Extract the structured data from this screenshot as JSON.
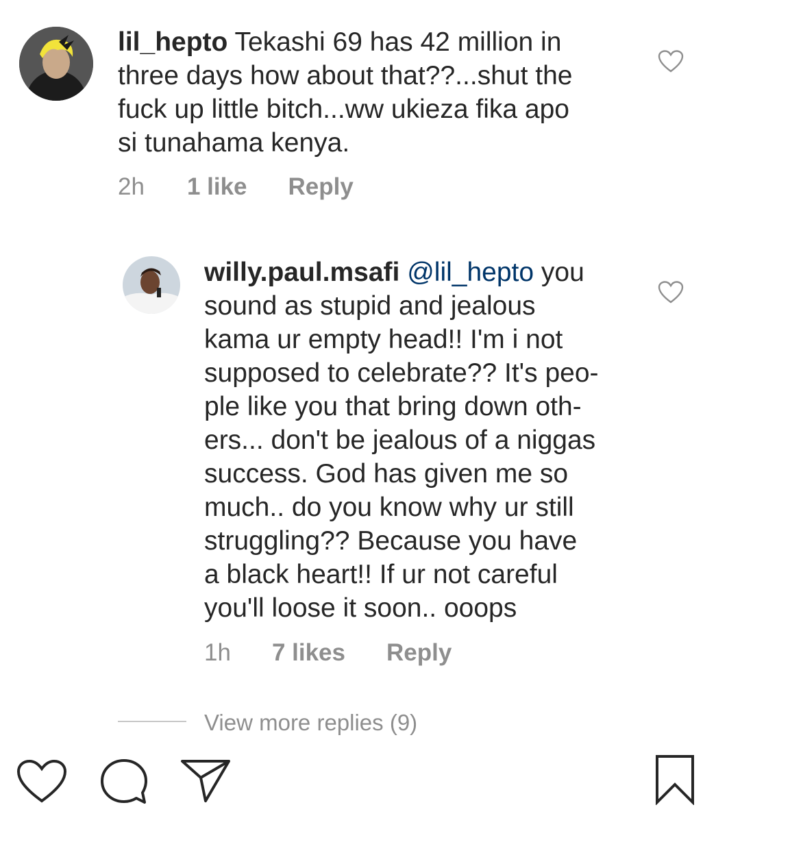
{
  "comment1": {
    "username": "lil_hepto",
    "lines": [
      " Tekashi 69 has 42 million in",
      "three days how about that??...shut the",
      "fuck up little bitch...ww ukieza fika apo",
      "si tunahama kenya."
    ],
    "time": "2h",
    "likes": "1 like",
    "reply": "Reply"
  },
  "comment2": {
    "username": "willy.paul.msafi",
    "mention": "@lil_hepto",
    "first_line_rest": " you",
    "lines": [
      "sound as stupid and jealous",
      "kama ur empty head!! I'm i not",
      "supposed to celebrate?? It's peo-",
      "ple like you that bring down oth-",
      "ers... don't be jealous of a niggas",
      "success. God has given me so",
      "much.. do you know why ur still",
      "struggling?? Because you have",
      "a black heart!! If ur not careful",
      "you'll loose it soon.. ooops"
    ],
    "time": "1h",
    "likes": "7 likes",
    "reply": "Reply"
  },
  "view_more": "View more replies (9)",
  "icons": {
    "like": "heart-icon",
    "comment": "comment-icon",
    "share": "send-icon",
    "save": "bookmark-icon"
  }
}
